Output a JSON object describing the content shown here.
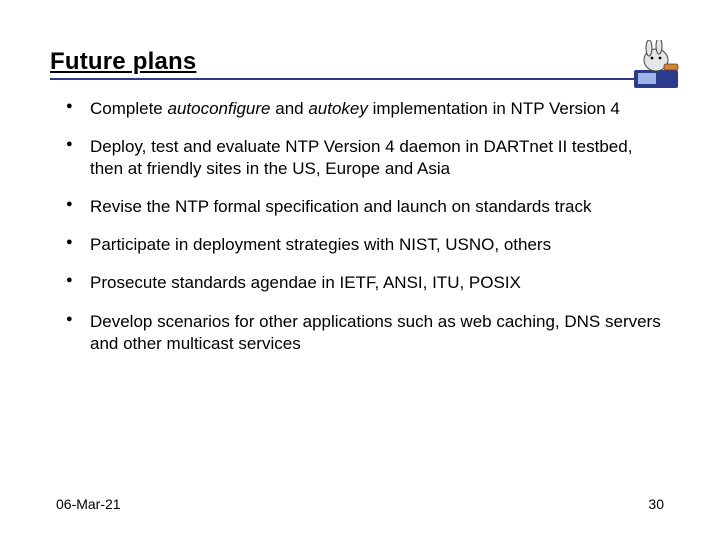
{
  "title": "Future plans",
  "bullets": [
    {
      "pre": "Complete ",
      "em1": "autoconfigure",
      "mid": " and ",
      "em2": "autokey",
      "post": " implementation in NTP Version 4"
    },
    {
      "text": "Deploy, test and evaluate NTP Version 4 daemon in DARTnet II testbed, then at friendly sites in the US, Europe and Asia"
    },
    {
      "text": "Revise the NTP formal specification and launch on standards track"
    },
    {
      "text": "Participate in deployment strategies with NIST, USNO, others"
    },
    {
      "text": "Prosecute standards agendae in IETF, ANSI, ITU, POSIX"
    },
    {
      "text": "Develop scenarios for other applications such as web caching, DNS servers and other multicast services"
    }
  ],
  "footer": {
    "date": "06-Mar-21",
    "page": "30"
  }
}
